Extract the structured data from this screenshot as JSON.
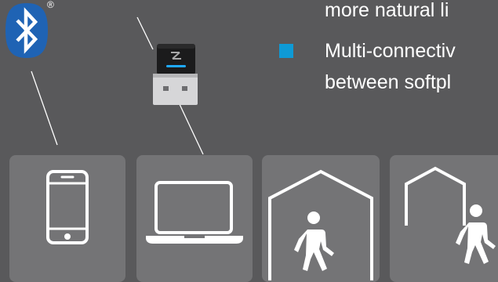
{
  "badges": {
    "bluetooth_icon": "bluetooth-icon",
    "registered_mark": "®"
  },
  "features": {
    "continued_text": "more natural li",
    "bullet_line_1": "Multi-connectiv",
    "bullet_line_2": "between softpl"
  },
  "tiles": [
    {
      "icon": "smartphone-icon"
    },
    {
      "icon": "laptop-icon"
    },
    {
      "icon": "person-inside-building-icon"
    },
    {
      "icon": "person-outside-building-icon"
    }
  ],
  "colors": {
    "background": "#59595b",
    "tile": "#747476",
    "bluetooth_blue": "#1f63b4",
    "bullet_blue": "#0e9ad6",
    "dongle_led": "#1fa9ff",
    "icon_stroke": "#ffffff"
  }
}
